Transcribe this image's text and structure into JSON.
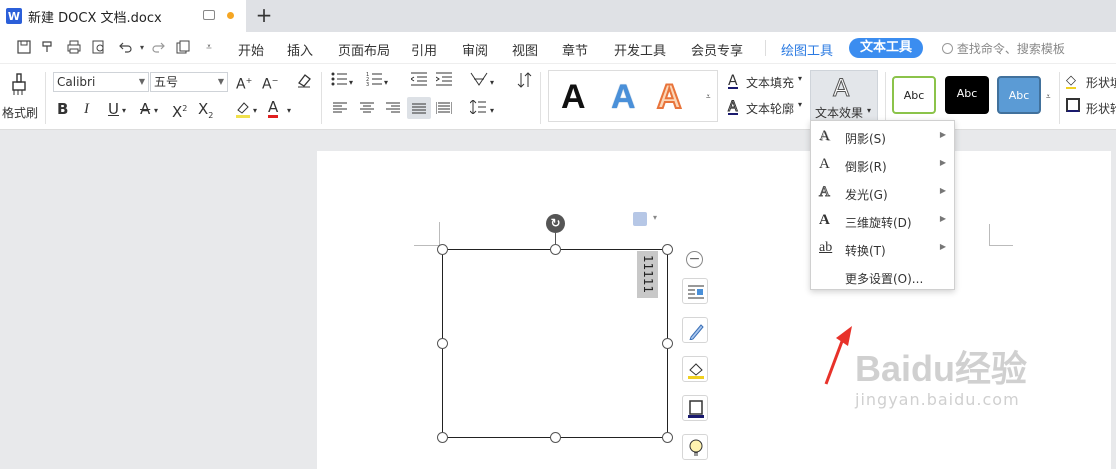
{
  "tab": {
    "logo": "W",
    "title": "新建 DOCX 文档.docx",
    "new_tab": "+"
  },
  "menu": {
    "items": [
      "开始",
      "插入",
      "页面布局",
      "引用",
      "审阅",
      "视图",
      "章节",
      "开发工具",
      "会员专享"
    ],
    "drawing_tools": "绘图工具",
    "text_tools": "文本工具",
    "search": "查找命令、搜索模板"
  },
  "ribbon": {
    "format_painter": "格式刷",
    "font_name": "Calibri",
    "font_size": "五号",
    "text_fill": "文本填充",
    "text_outline": "文本轮廓",
    "text_effect": "文本效果",
    "shape_fill": "形状填",
    "shape_outline": "形状轮",
    "shape_styles": [
      "Abc",
      "Abc",
      "Abc"
    ],
    "art_letter": "A",
    "bold": "B",
    "italic": "I",
    "underline": "U"
  },
  "dropdown": {
    "items": [
      {
        "icon": "A",
        "label": "阴影(S)",
        "submenu": true
      },
      {
        "icon": "A",
        "label": "倒影(R)",
        "submenu": true
      },
      {
        "icon": "A",
        "label": "发光(G)",
        "submenu": true
      },
      {
        "icon": "A",
        "label": "三维旋转(D)",
        "submenu": true
      },
      {
        "icon": "ab",
        "label": "转换(T)",
        "submenu": true
      }
    ],
    "more": "更多设置(O)..."
  },
  "document": {
    "textbox_text": "11111"
  },
  "watermark": {
    "brand": "Baidu经验",
    "url": "jingyan.baidu.com"
  },
  "colors": {
    "accent": "#3b8df0",
    "red_arrow": "#e8322a"
  }
}
